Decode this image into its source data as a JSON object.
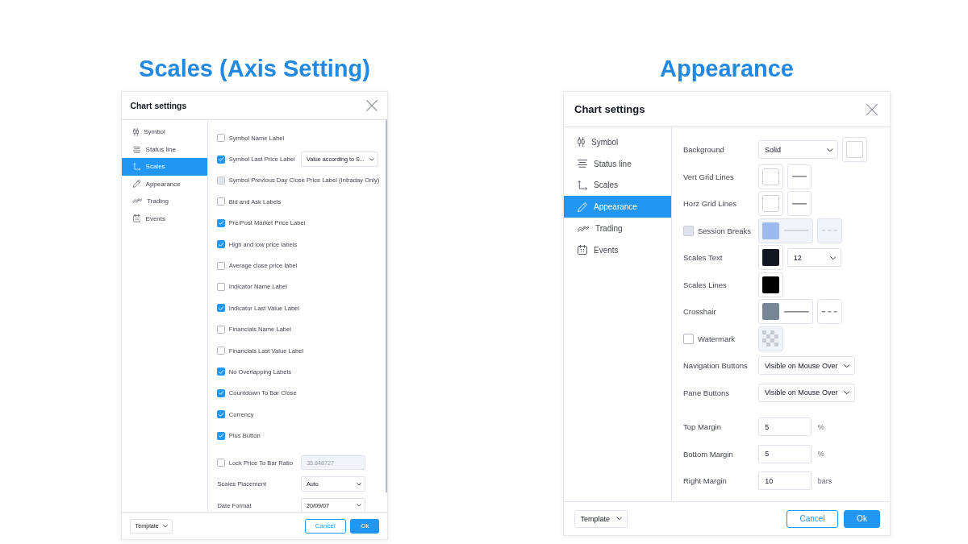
{
  "panels": [
    {
      "heading": "Scales (Axis Setting)",
      "dialog": {
        "title": "Chart settings",
        "sidebar": [
          {
            "label": "Symbol",
            "selected": false
          },
          {
            "label": "Status line",
            "selected": false
          },
          {
            "label": "Scales",
            "selected": true
          },
          {
            "label": "Appearance",
            "selected": false
          },
          {
            "label": "Trading",
            "selected": false
          },
          {
            "label": "Events",
            "selected": false
          }
        ],
        "sections": [
          [
            {
              "label": "Symbol Name Label",
              "checkbox": {
                "checked": false,
                "disabled": false
              }
            },
            {
              "label": "Symbol Last Price Label",
              "checkbox": {
                "checked": true,
                "disabled": false
              },
              "controls": [
                {
                  "kind": "select",
                  "value": "Value according to S..."
                }
              ]
            },
            {
              "label": "Symbol Previous Day Close Price Label (Intraday Only)",
              "checkbox": {
                "checked": false,
                "disabled": true
              }
            },
            {
              "label": "Bid and Ask Labels",
              "checkbox": {
                "checked": false,
                "disabled": false
              }
            },
            {
              "label": "Pre/Post Market Price Label",
              "checkbox": {
                "checked": true,
                "disabled": false
              }
            },
            {
              "label": "High and low price labels",
              "checkbox": {
                "checked": true,
                "disabled": false
              }
            },
            {
              "label": "Average close price label",
              "checkbox": {
                "checked": false,
                "disabled": false
              }
            },
            {
              "label": "Indicator Name Label",
              "checkbox": {
                "checked": false,
                "disabled": false
              }
            },
            {
              "label": "Indicator Last Value Label",
              "checkbox": {
                "checked": true,
                "disabled": false
              }
            },
            {
              "label": "Financials Name Label",
              "checkbox": {
                "checked": false,
                "disabled": false
              }
            },
            {
              "label": "Financials Last Value Label",
              "checkbox": {
                "checked": false,
                "disabled": false
              }
            },
            {
              "label": "No Overlapping Labels",
              "checkbox": {
                "checked": true,
                "disabled": false
              }
            },
            {
              "label": "Countdown To Bar Close",
              "checkbox": {
                "checked": true,
                "disabled": false
              }
            },
            {
              "label": "Currency",
              "checkbox": {
                "checked": true,
                "disabled": false
              }
            },
            {
              "label": "Plus Button",
              "checkbox": {
                "checked": true,
                "disabled": false
              }
            }
          ],
          [
            {
              "label": "Lock Price To Bar Ratio",
              "checkbox": {
                "checked": false,
                "disabled": false
              },
              "controls": [
                {
                  "kind": "input",
                  "value": "35.848727",
                  "disabled": true
                }
              ]
            },
            {
              "label": "Scales Placement",
              "controls": [
                {
                  "kind": "select",
                  "value": "Auto"
                }
              ]
            },
            {
              "label": "Date Format",
              "controls": [
                {
                  "kind": "select",
                  "value": "20/09/07"
                }
              ]
            }
          ]
        ],
        "footer": {
          "template": "Template",
          "buttons": [
            {
              "label": "Cancel",
              "primary": false
            },
            {
              "label": "Ok",
              "primary": true
            }
          ]
        }
      }
    },
    {
      "heading": "Appearance",
      "dialog": {
        "title": "Chart settings",
        "sidebar": [
          {
            "label": "Symbol",
            "selected": false
          },
          {
            "label": "Status line",
            "selected": false
          },
          {
            "label": "Scales",
            "selected": false
          },
          {
            "label": "Appearance",
            "selected": true
          },
          {
            "label": "Trading",
            "selected": false
          },
          {
            "label": "Events",
            "selected": false
          }
        ],
        "sections": [
          [
            {
              "label": "Background",
              "controls": [
                {
                  "kind": "select",
                  "value": "Solid"
                },
                {
                  "kind": "swatch",
                  "color": "#ffffff"
                }
              ]
            },
            {
              "label": "Vert Grid Lines",
              "controls": [
                {
                  "kind": "swatch",
                  "color": "#ffffff"
                },
                {
                  "kind": "line_style",
                  "dashed": false,
                  "disabled": false
                }
              ]
            },
            {
              "label": "Horz Grid Lines",
              "controls": [
                {
                  "kind": "swatch",
                  "color": "#ffffff"
                },
                {
                  "kind": "line_style",
                  "dashed": false,
                  "disabled": false
                }
              ]
            },
            {
              "label": "Session Breaks",
              "checkbox": {
                "checked": false,
                "disabled": true
              },
              "controls": [
                {
                  "kind": "color_line",
                  "color": "#9dbaee",
                  "disabled": true
                },
                {
                  "kind": "line_style",
                  "dashed": true,
                  "disabled": true
                }
              ]
            },
            {
              "label": "Scales Text",
              "controls": [
                {
                  "kind": "swatch",
                  "color": "#131722"
                },
                {
                  "kind": "select",
                  "value": "12"
                }
              ]
            },
            {
              "label": "Scales Lines",
              "controls": [
                {
                  "kind": "swatch",
                  "color": "#000000"
                }
              ]
            },
            {
              "label": "Crosshair",
              "controls": [
                {
                  "kind": "color_line",
                  "color": "#758696",
                  "disabled": false
                },
                {
                  "kind": "line_style",
                  "dashed": true,
                  "disabled": false
                }
              ]
            },
            {
              "label": "Watermark",
              "checkbox": {
                "checked": false,
                "disabled": false
              },
              "controls": [
                {
                  "kind": "pattern_swatch",
                  "disabled": true
                }
              ]
            },
            {
              "label": "Navigation Buttons",
              "controls": [
                {
                  "kind": "select",
                  "value": "Visible on Mouse Over"
                }
              ]
            },
            {
              "label": "Pane Buttons",
              "controls": [
                {
                  "kind": "select",
                  "value": "Visible on Mouse Over"
                }
              ]
            }
          ],
          [
            {
              "label": "Top Margin",
              "controls": [
                {
                  "kind": "input",
                  "value": "5",
                  "disabled": false
                },
                {
                  "kind": "unit",
                  "text": "%"
                }
              ]
            },
            {
              "label": "Bottom Margin",
              "controls": [
                {
                  "kind": "input",
                  "value": "5",
                  "disabled": false
                },
                {
                  "kind": "unit",
                  "text": "%"
                }
              ]
            },
            {
              "label": "Right Margin",
              "controls": [
                {
                  "kind": "input",
                  "value": "10",
                  "disabled": false
                },
                {
                  "kind": "unit",
                  "text": "bars"
                }
              ]
            }
          ]
        ],
        "footer": {
          "template": "Template",
          "buttons": [
            {
              "label": "Cancel",
              "primary": false
            },
            {
              "label": "Ok",
              "primary": true
            }
          ]
        }
      }
    }
  ]
}
